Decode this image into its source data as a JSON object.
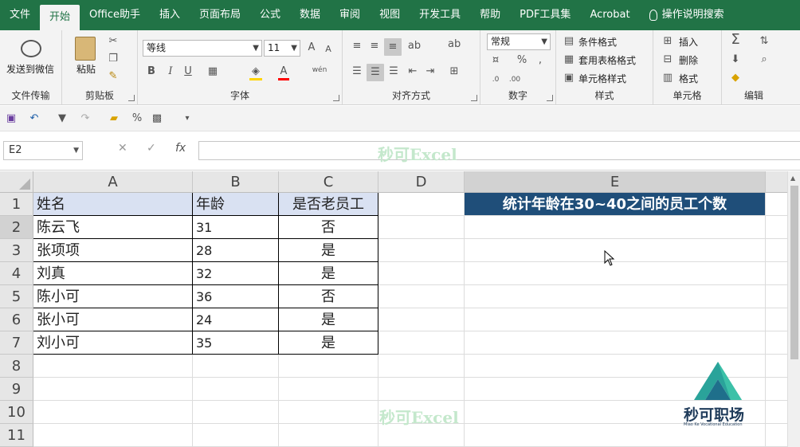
{
  "tabs": [
    "文件",
    "开始",
    "Office助手",
    "插入",
    "页面布局",
    "公式",
    "数据",
    "审阅",
    "视图",
    "开发工具",
    "帮助",
    "PDF工具集",
    "Acrobat"
  ],
  "active_tab": "开始",
  "search_label": "操作说明搜索",
  "ribbon": {
    "wechat": {
      "label": "发送到微信",
      "group": "文件传输"
    },
    "clipboard": {
      "paste": "粘贴",
      "group": "剪贴板"
    },
    "font": {
      "name": "等线",
      "size": "11",
      "group": "字体",
      "bold": "B",
      "italic": "I",
      "underline": "U",
      "grow": "A",
      "shrink": "A",
      "color_a": "A",
      "phonetic": "wén"
    },
    "align": {
      "group": "对齐方式"
    },
    "number": {
      "format": "常规",
      "percent": "%",
      "comma": ",",
      "group": "数字"
    },
    "styles": {
      "cond": "条件格式",
      "table": "套用表格格式",
      "cell": "单元格样式",
      "group": "样式"
    },
    "cells": {
      "insert": "插入",
      "delete": "删除",
      "format": "格式",
      "group": "单元格"
    },
    "edit": {
      "sum": "Σ",
      "group": "编辑"
    }
  },
  "namebox": "E2",
  "fx": "fx",
  "watermark": "秒可Excel",
  "columns": [
    "A",
    "B",
    "C",
    "D",
    "E"
  ],
  "rows": [
    "1",
    "2",
    "3",
    "4",
    "5",
    "6",
    "7",
    "8",
    "9",
    "10",
    "11"
  ],
  "table": {
    "headers": [
      "姓名",
      "年龄",
      "是否老员工"
    ],
    "data": [
      [
        "陈云飞",
        "31",
        "否"
      ],
      [
        "张项项",
        "28",
        "是"
      ],
      [
        "刘真",
        "32",
        "是"
      ],
      [
        "陈小可",
        "36",
        "否"
      ],
      [
        "张小可",
        "24",
        "是"
      ],
      [
        "刘小可",
        "35",
        "是"
      ]
    ]
  },
  "e1_text": "统计年龄在30~40之间的员工个数",
  "logo": {
    "title": "秒可职场",
    "subtitle": "Miao Ke Vocational Education"
  },
  "colors": {
    "excel_green": "#217346",
    "header_fill": "#d9e1f2",
    "title_fill": "#1f4e79"
  }
}
